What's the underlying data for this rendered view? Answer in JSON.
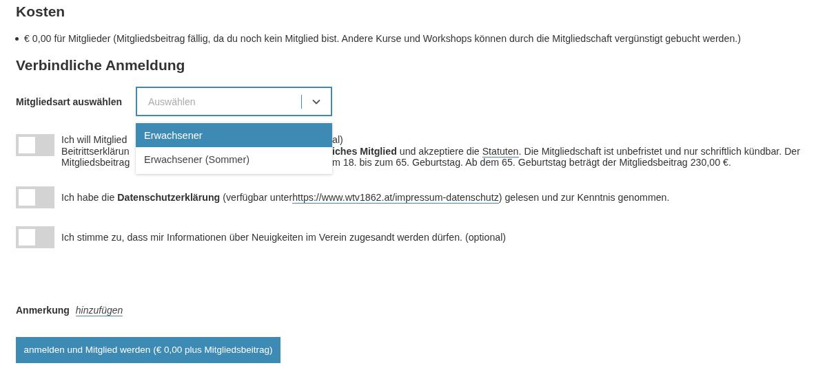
{
  "costs": {
    "title": "Kosten",
    "items": [
      "€ 0,00 für Mitglieder (Mitgliedsbeitrag fällig, da du noch kein Mitglied bist. Andere Kurse und Workshops können durch die Mitgliedschaft vergünstigt gebucht werden.)"
    ]
  },
  "registration": {
    "title": "Verbindliche Anmeldung",
    "select": {
      "label": "Mitgliedsart auswählen",
      "placeholder": "Auswählen",
      "expanded": true,
      "options": [
        {
          "label": "Erwachsener",
          "selected": true
        },
        {
          "label": "Erwachsener (Sommer)",
          "selected": false
        }
      ]
    },
    "consents": [
      {
        "checked": false,
        "lines": [
          [
            {
              "kind": "text",
              "text": "Ich will Mitglied"
            },
            {
              "kind": "covered"
            },
            {
              "kind": "text",
              "text": "al)"
            }
          ],
          [
            {
              "kind": "text",
              "text": "Beitrittserklärun"
            },
            {
              "kind": "covered"
            },
            {
              "kind": "text",
              "text": "**iches Mitglied** und akzeptiere die "
            },
            {
              "kind": "link",
              "text": "Statuten"
            },
            {
              "kind": "text",
              "text": ". Die Mitgliedschaft ist unbefristet und nur schriftlich kündbar. Der"
            }
          ],
          [
            {
              "kind": "text",
              "text": "Mitgliedsbeitrag"
            },
            {
              "kind": "covered"
            },
            {
              "kind": "text",
              "text": "m 18. bis zum 65. Geburtstag. Ab dem 65. Geburtstag beträgt der Mitgliedsbeitrag 230,00 €."
            }
          ]
        ]
      },
      {
        "checked": false,
        "lines": [
          [
            {
              "kind": "text",
              "text": "Ich habe die **Datenschutzerklärung** (verfügbar unter "
            },
            {
              "kind": "link",
              "text": "https://www.wtv1862.at/impressum-datenschutz"
            },
            {
              "kind": "text",
              "text": ") gelesen und zur Kenntnis genommen."
            }
          ]
        ]
      },
      {
        "checked": false,
        "lines": [
          [
            {
              "kind": "text",
              "text": "Ich stimme zu, dass mir Informationen über Neuigkeiten im Verein zugesandt werden dürfen. (optional)"
            }
          ]
        ]
      }
    ],
    "note": {
      "label": "Anmerkung",
      "link": "hinzufügen"
    },
    "submit": "anmelden und Mitglied werden (€ 0,00 plus Mitgliedsbeitrag)"
  }
}
